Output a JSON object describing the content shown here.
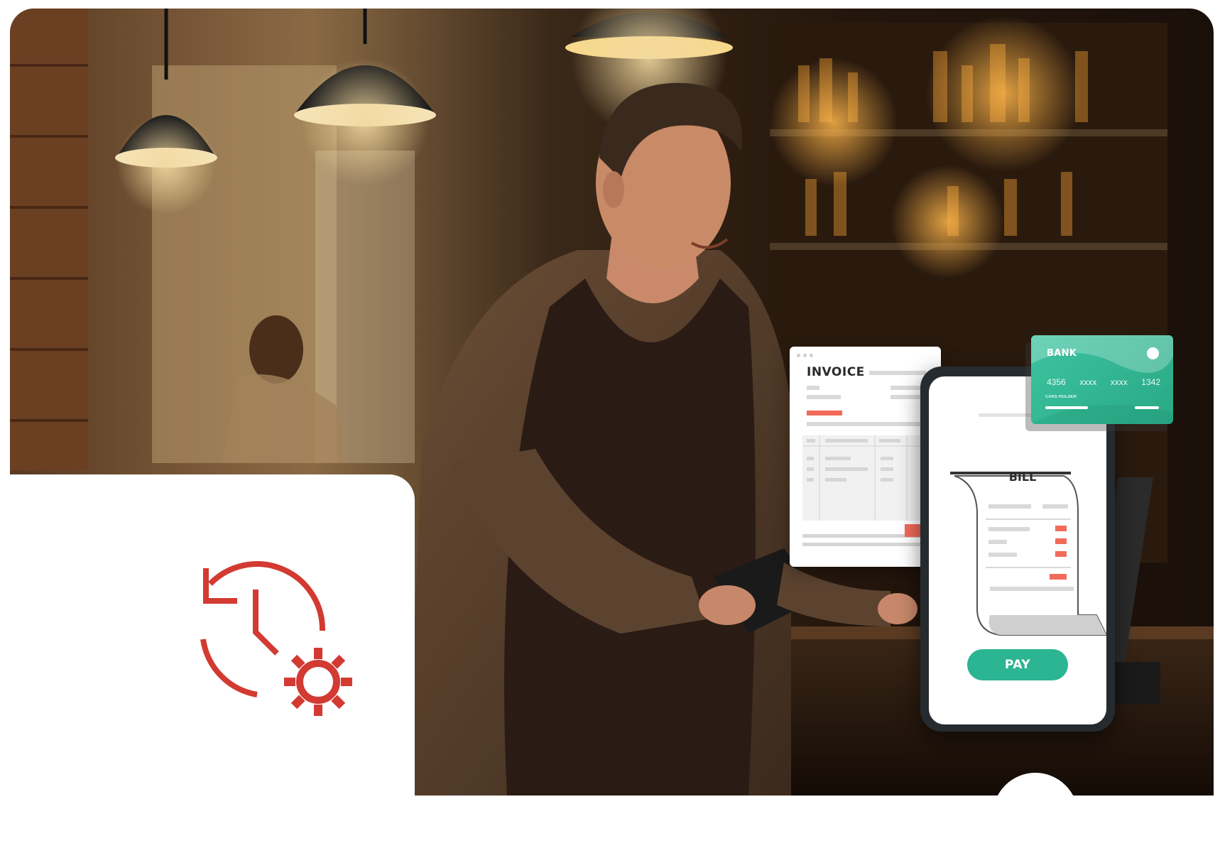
{
  "colors": {
    "accent_red": "#d23a32",
    "brand_green": "#2bb592",
    "invoice_highlight": "#f26a5a"
  },
  "feature": {
    "icon": "clock-history-gear-icon"
  },
  "invoice": {
    "title": "INVOICE"
  },
  "phone": {
    "bill_title": "BILL",
    "pay_label": "PAY"
  },
  "bank_card": {
    "name": "BANK",
    "number_groups": [
      "4356",
      "xxxx",
      "xxxx",
      "1342"
    ],
    "holder_label": "CARS HOLDER"
  },
  "photo": {
    "subject": "waiter-with-tablet-photo"
  }
}
